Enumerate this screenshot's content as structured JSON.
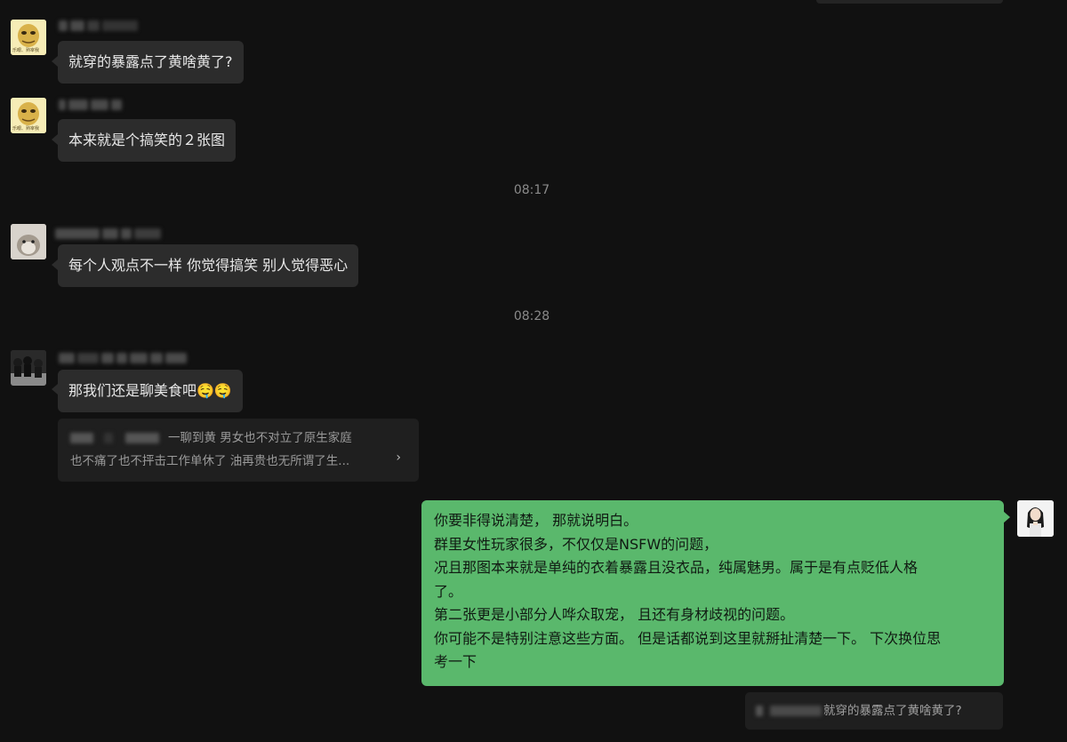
{
  "messages": [
    {
      "text": "就穿的暴露点了黄啥黄了?"
    },
    {
      "text": "本来就是个搞笑的２张图"
    },
    {
      "text": "每个人观点不一样 你觉得搞笑 别人觉得恶心"
    },
    {
      "text": "那我们还是聊美食吧🤤🤤"
    }
  ],
  "avatar_caption": "乐眼、熟宰我",
  "timestamps": [
    "08:17",
    "08:28"
  ],
  "quote": {
    "line1": "一聊到黄 男女也不对立了原生家庭",
    "line2": "也不痛了也不抨击工作单休了 油再贵也无所谓了生...",
    "arrow": "›"
  },
  "self_message": {
    "lines": [
      "你要非得说清楚， 那就说明白。",
      "群里女性玩家很多，不仅仅是NSFW的问题，",
      "况且那图本来就是单纯的衣着暴露且没衣品，纯属魅男。属于是有点贬低人格",
      "了。",
      "第二张更是小部分人哗众取宠， 且还有身材歧视的问题。",
      "你可能不是特别注意这些方面。 但是话都说到这里就掰扯清楚一下。 下次换位思",
      "考一下"
    ]
  },
  "self_quote": {
    "text": "就穿的暴露点了黄啥黄了?"
  },
  "colors": {
    "background": "#111111",
    "bubble_other": "#2c2c2c",
    "bubble_self": "#5ab86c"
  }
}
